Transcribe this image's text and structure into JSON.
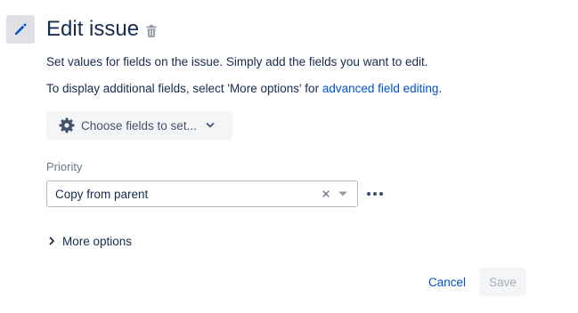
{
  "header": {
    "title": "Edit issue",
    "edit_icon": "pencil-icon",
    "delete_icon": "trash-icon"
  },
  "description": {
    "line1": "Set values for fields on the issue. Simply add the fields you want to edit.",
    "line2_prefix": "To display additional fields, select 'More options' for ",
    "line2_link": "advanced field editing",
    "line2_suffix": "."
  },
  "choose_fields": {
    "label": "Choose fields to set...",
    "icon": "gear-icon",
    "chevron": "chevron-down-icon"
  },
  "priority": {
    "label": "Priority",
    "value": "Copy from parent",
    "clear_icon": "close-icon",
    "dropdown_icon": "caret-down-icon",
    "more_icon": "more-horizontal-icon"
  },
  "more_options": {
    "label": "More options",
    "icon": "chevron-right-icon"
  },
  "footer": {
    "cancel_label": "Cancel",
    "save_label": "Save",
    "save_disabled": true
  },
  "colors": {
    "text": "#172b4d",
    "link": "#0052cc",
    "subtle_text": "#6b778c",
    "disabled_text": "#a5adba",
    "button_bg": "#f4f5f7",
    "icon_box_bg": "#dfe1e6"
  }
}
